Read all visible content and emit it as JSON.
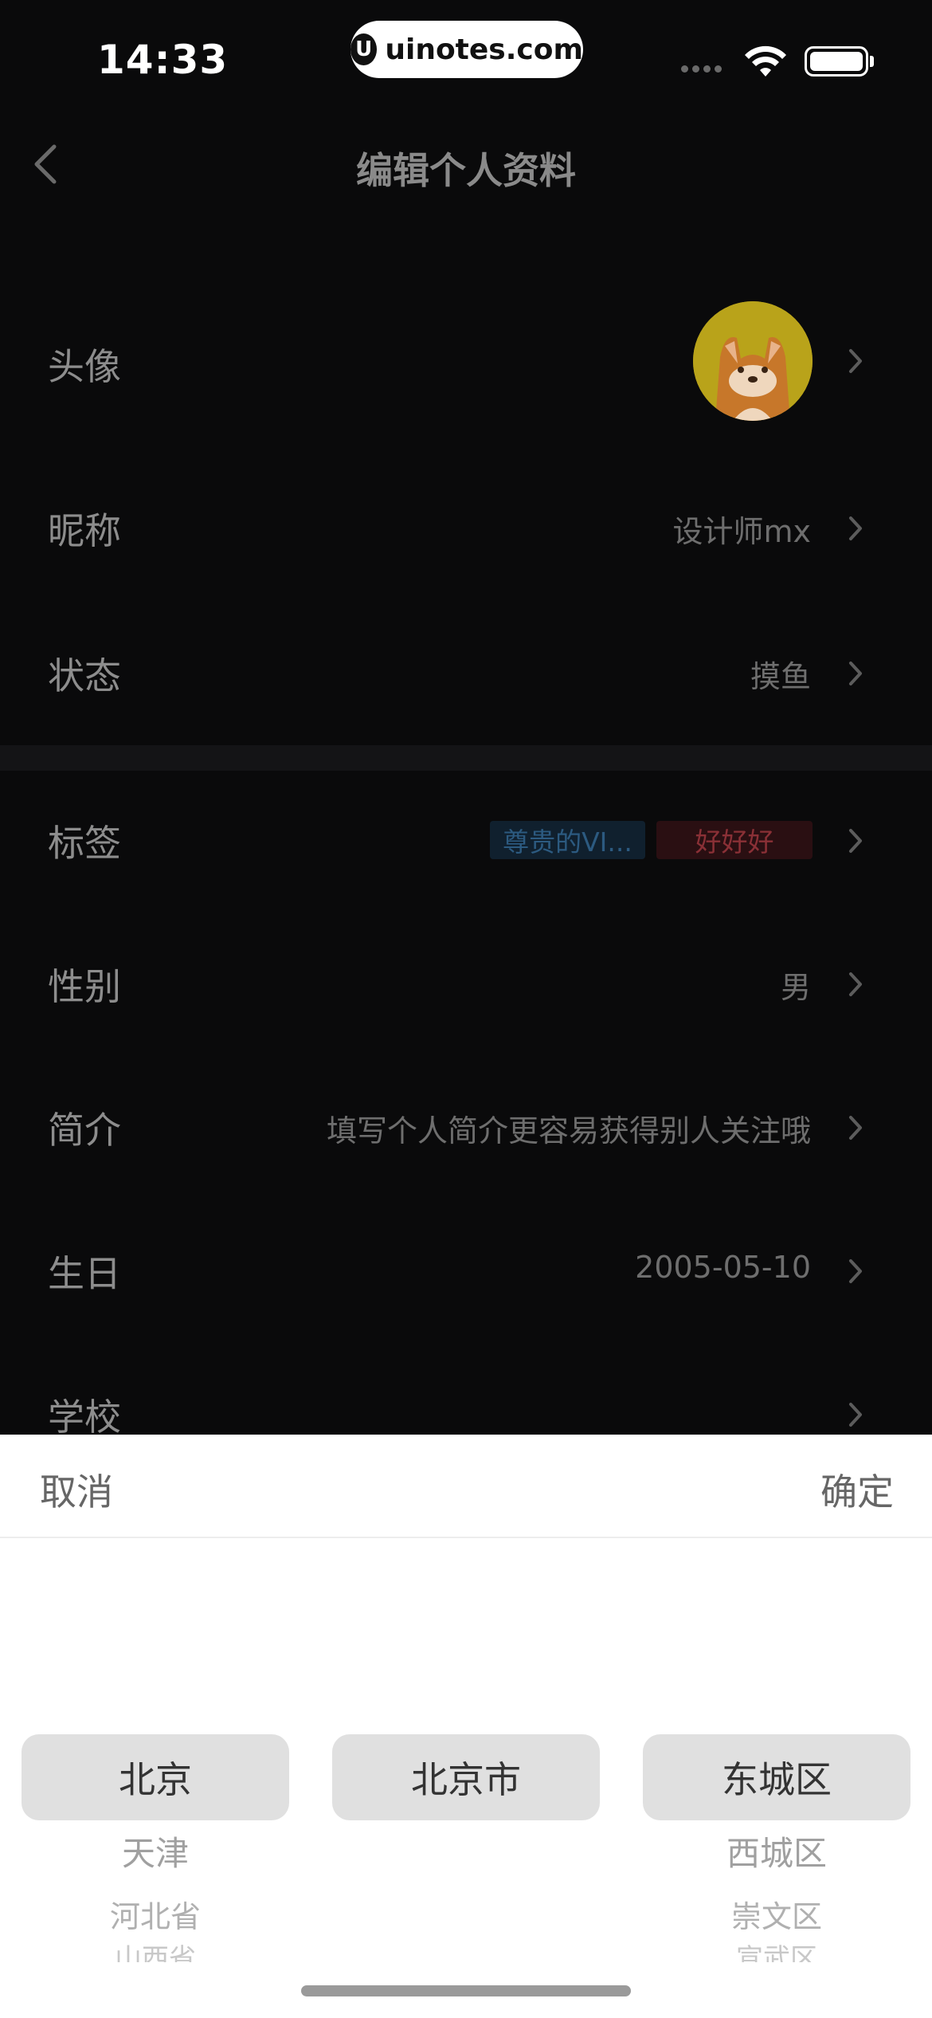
{
  "status_bar": {
    "time": "14:33",
    "brand": "uinotes.com",
    "brand_logo": "U"
  },
  "nav": {
    "title": "编辑个人资料"
  },
  "rows": {
    "avatar": {
      "label": "头像"
    },
    "nickname": {
      "label": "昵称",
      "value": "设计师mx"
    },
    "status": {
      "label": "状态",
      "value": "摸鱼"
    },
    "tags": {
      "label": "标签",
      "items": [
        "尊贵的VI...",
        "好好好"
      ]
    },
    "gender": {
      "label": "性别",
      "value": "男"
    },
    "bio": {
      "label": "简介",
      "placeholder": "填写个人简介更容易获得别人关注哦"
    },
    "birthday": {
      "label": "生日",
      "value": "2005-05-10"
    },
    "school": {
      "label": "学校"
    }
  },
  "picker": {
    "cancel_label": "取消",
    "confirm_label": "确定",
    "provinces": {
      "selected": "北京",
      "items": [
        "天津",
        "河北省",
        "山西省"
      ]
    },
    "cities": {
      "selected": "北京市",
      "items": []
    },
    "districts": {
      "selected": "东城区",
      "items": [
        "西城区",
        "崇文区",
        "宣武区"
      ]
    }
  },
  "colors": {
    "sheet_bg": "#ffffff",
    "page_bg": "#0a0a0b",
    "selection_bg": "#e0e0e0"
  }
}
